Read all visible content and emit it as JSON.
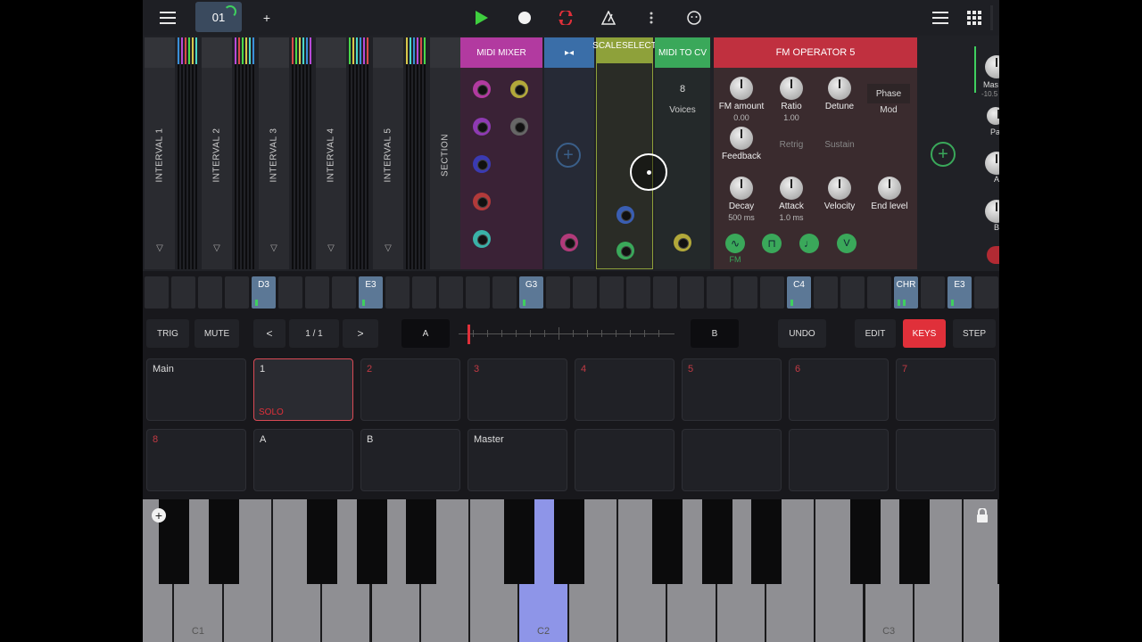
{
  "toolbar": {
    "pattern_label": "01",
    "add_label": "+",
    "icons": [
      "menu-icon",
      "play-icon",
      "record-icon",
      "loop-icon",
      "metronome-icon",
      "more-icon",
      "smiley-icon",
      "list-icon",
      "grid-icon"
    ]
  },
  "rack": {
    "strips": [
      "INTERVAL 1",
      "INTERVAL 2",
      "INTERVAL 3",
      "INTERVAL 4",
      "INTERVAL 5",
      "SECTION"
    ],
    "strip_marker": "▽",
    "midi_mixer": {
      "title": "MIDI MIXER",
      "color": "#b23aa0"
    },
    "bus": {
      "title": "▸◂",
      "color": "#3a6ea8"
    },
    "scaleselect": {
      "title": "SCALESELECT",
      "color": "#8ea13a"
    },
    "midi_to_cv": {
      "title": "MIDI TO CV",
      "color": "#3aa85a",
      "voices_value": "8",
      "voices_label": "Voices"
    },
    "fm_operator": {
      "title": "FM OPERATOR 5",
      "color": "#c0303f",
      "knobs": [
        {
          "label": "FM amount",
          "value": "0.00"
        },
        {
          "label": "Ratio",
          "value": "1.00"
        },
        {
          "label": "Detune",
          "value": ""
        },
        {
          "label": "Feedback",
          "value": ""
        },
        {
          "label": "Decay",
          "value": "500 ms"
        },
        {
          "label": "Attack",
          "value": "1.0 ms"
        },
        {
          "label": "Velocity",
          "value": ""
        },
        {
          "label": "End level",
          "value": ""
        }
      ],
      "phase_label": "Phase",
      "mod_label": "Mod",
      "retrig_label": "Retrig",
      "sustain_label": "Sustain",
      "fm_label": "FM"
    },
    "right_module": {
      "master_label": "Mas",
      "master_value": "-10.5",
      "p_label": "Pa",
      "a_label": "A",
      "b_label": "B"
    }
  },
  "steps": {
    "notes": {
      "4": "D3",
      "8": "E3",
      "14": "G3",
      "24": "C4",
      "28": "CHR",
      "30": "E3"
    }
  },
  "controls": {
    "trig": "TRIG",
    "mute": "MUTE",
    "prev": "<",
    "page": "1 / 1",
    "next": ">",
    "a": "A",
    "b": "B",
    "undo": "UNDO",
    "edit": "EDIT",
    "keys": "KEYS",
    "step": "STEP"
  },
  "pads": [
    {
      "label": "Main",
      "num": ""
    },
    {
      "label": "1",
      "num": "",
      "solo": "SOLO",
      "selected": true
    },
    {
      "label": "",
      "num": "2"
    },
    {
      "label": "",
      "num": "3"
    },
    {
      "label": "",
      "num": "4"
    },
    {
      "label": "",
      "num": "5"
    },
    {
      "label": "",
      "num": "6"
    },
    {
      "label": "",
      "num": "7"
    },
    {
      "label": "",
      "num": "8"
    },
    {
      "label": "A",
      "num": ""
    },
    {
      "label": "B",
      "num": ""
    },
    {
      "label": "Master",
      "num": ""
    },
    {
      "label": "",
      "num": ""
    },
    {
      "label": "",
      "num": ""
    },
    {
      "label": "",
      "num": ""
    },
    {
      "label": "",
      "num": ""
    }
  ],
  "keyboard": {
    "labels": {
      "1": "C1",
      "8": "C2",
      "15": "C3"
    },
    "highlighted_key": 8,
    "accent": "#8e95e8"
  }
}
